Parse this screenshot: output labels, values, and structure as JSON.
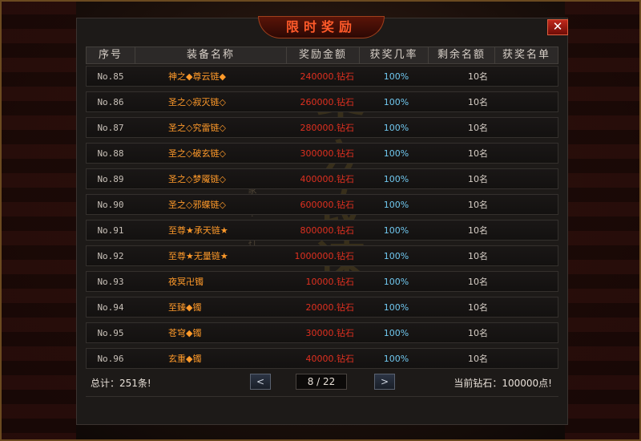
{
  "window": {
    "title": "限时奖励",
    "close_label": "✕"
  },
  "columns": [
    "序号",
    "装备名称",
    "奖励金额",
    "获奖几率",
    "剩余名额",
    "获奖名单"
  ],
  "watermark": {
    "big": "圣安攻速",
    "small": "独家版本 · 匠心打造"
  },
  "rows": [
    {
      "no": "No.85",
      "name": "神之◆尊云链◆",
      "amount": "240000.钻石",
      "rate": "100%",
      "left": "10名",
      "winners": ""
    },
    {
      "no": "No.86",
      "name": "圣之◇寂灭链◇",
      "amount": "260000.钻石",
      "rate": "100%",
      "left": "10名",
      "winners": ""
    },
    {
      "no": "No.87",
      "name": "圣之◇究雷链◇",
      "amount": "280000.钻石",
      "rate": "100%",
      "left": "10名",
      "winners": ""
    },
    {
      "no": "No.88",
      "name": "圣之◇破玄链◇",
      "amount": "300000.钻石",
      "rate": "100%",
      "left": "10名",
      "winners": ""
    },
    {
      "no": "No.89",
      "name": "圣之◇梦魇链◇",
      "amount": "400000.钻石",
      "rate": "100%",
      "left": "10名",
      "winners": ""
    },
    {
      "no": "No.90",
      "name": "圣之◇邪蝶链◇",
      "amount": "600000.钻石",
      "rate": "100%",
      "left": "10名",
      "winners": ""
    },
    {
      "no": "No.91",
      "name": "至尊★承天链★",
      "amount": "800000.钻石",
      "rate": "100%",
      "left": "10名",
      "winners": ""
    },
    {
      "no": "No.92",
      "name": "至尊★无量链★",
      "amount": "1000000.钻石",
      "rate": "100%",
      "left": "10名",
      "winners": ""
    },
    {
      "no": "No.93",
      "name": "夜冥卍镯",
      "amount": "10000.钻石",
      "rate": "100%",
      "left": "10名",
      "winners": ""
    },
    {
      "no": "No.94",
      "name": "至臻◆镯",
      "amount": "20000.钻石",
      "rate": "100%",
      "left": "10名",
      "winners": ""
    },
    {
      "no": "No.95",
      "name": "苍穹◆镯",
      "amount": "30000.钻石",
      "rate": "100%",
      "left": "10名",
      "winners": ""
    },
    {
      "no": "No.96",
      "name": "玄重◆镯",
      "amount": "40000.钻石",
      "rate": "100%",
      "left": "10名",
      "winners": ""
    }
  ],
  "footer": {
    "total": "总计：251条!",
    "prev_label": "<",
    "next_label": ">",
    "page": "8 / 22",
    "diamonds": "当前钻石：100000点!"
  },
  "colors": {
    "title": "#ff5a2a",
    "item_name": "#ff9a2a",
    "amount": "#e03020",
    "rate": "#70c8f0"
  }
}
